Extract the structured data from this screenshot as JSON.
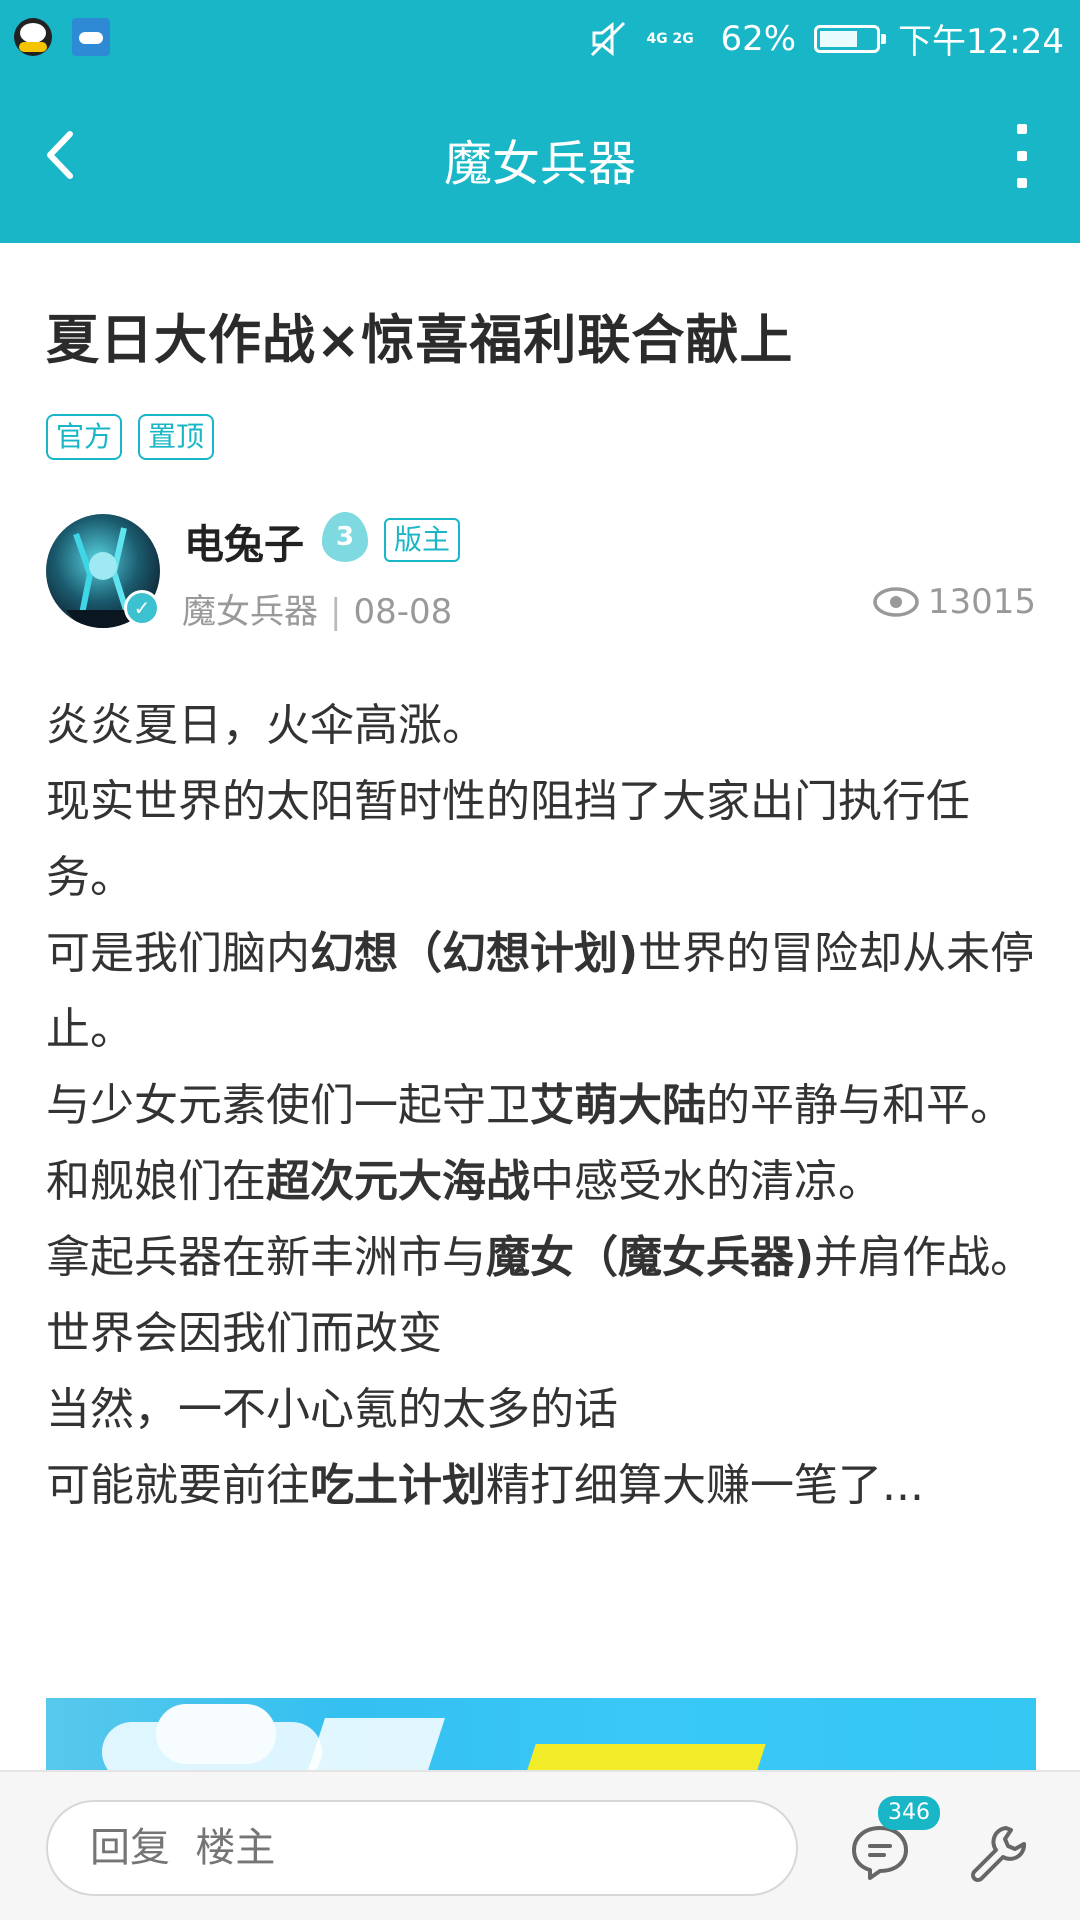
{
  "status_bar": {
    "network": "4G 2G",
    "battery": "62%",
    "battery_level": 0.62,
    "time": "下午12:24"
  },
  "app_bar": {
    "title": "魔女兵器",
    "back_icon": "chevron-left-icon",
    "more_icon": "more-vertical-icon"
  },
  "post": {
    "title": "夏日大作战×惊喜福利联合献上",
    "tags": [
      "官方",
      "置顶"
    ],
    "author": {
      "name": "电兔子",
      "level": "3",
      "role": "版主",
      "forum": "魔女兵器",
      "date": "08-08"
    },
    "views": "13015",
    "body": [
      [
        {
          "t": "炎炎夏日，火伞高涨。"
        }
      ],
      [
        {
          "t": "现实世界的太阳暂时性的阻挡了大家出门执行任务。"
        }
      ],
      [
        {
          "t": "可是我们脑内"
        },
        {
          "t": "幻想（幻想计划)",
          "b": true
        },
        {
          "t": "世界的冒险却从未停止。"
        }
      ],
      [
        {
          "t": "与少女元素使们一起守卫"
        },
        {
          "t": "艾萌大陆",
          "b": true
        },
        {
          "t": "的平静与和平。"
        }
      ],
      [
        {
          "t": "和舰娘们在"
        },
        {
          "t": "超次元大海战",
          "b": true
        },
        {
          "t": "中感受水的清凉。"
        }
      ],
      [
        {
          "t": "拿起兵器在新丰洲市与"
        },
        {
          "t": "魔女（魔女兵器)",
          "b": true
        },
        {
          "t": "并肩作战。"
        }
      ],
      [
        {
          "t": "世界会因我们而改变"
        }
      ],
      [
        {
          "t": "当然，一不小心氪的太多的话"
        }
      ],
      [
        {
          "t": "可能就要前往"
        },
        {
          "t": "吃土计划",
          "b": true
        },
        {
          "t": "精打细算大赚一笔了..."
        }
      ]
    ]
  },
  "bottom_bar": {
    "reply_placeholder": "回复  楼主",
    "comment_count": "346"
  },
  "colors": {
    "accent": "#18b6c6",
    "text": "#333333",
    "muted": "#999999"
  }
}
